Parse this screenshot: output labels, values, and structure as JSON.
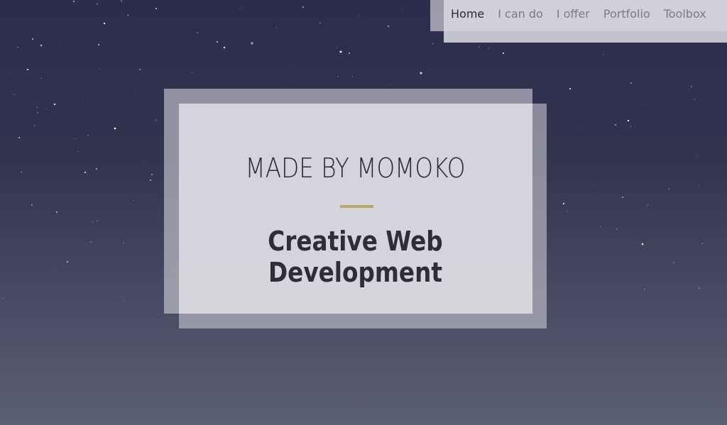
{
  "nav": {
    "items": [
      {
        "label": "Home",
        "active": true
      },
      {
        "label": "I can do",
        "active": false
      },
      {
        "label": "I offer",
        "active": false
      },
      {
        "label": "Portfolio",
        "active": false
      },
      {
        "label": "Toolbox",
        "active": false
      }
    ]
  },
  "hero": {
    "title": "MADE BY MOMOKO",
    "subtitle": "Creative Web Development",
    "divider_color": "#b9a766"
  },
  "colors": {
    "sky_top": "#2e2c4e",
    "sky_bottom": "#5b6074",
    "card": "#d6d6dd",
    "text_dark": "#2a2a33",
    "nav_text": "#7b7b88"
  }
}
